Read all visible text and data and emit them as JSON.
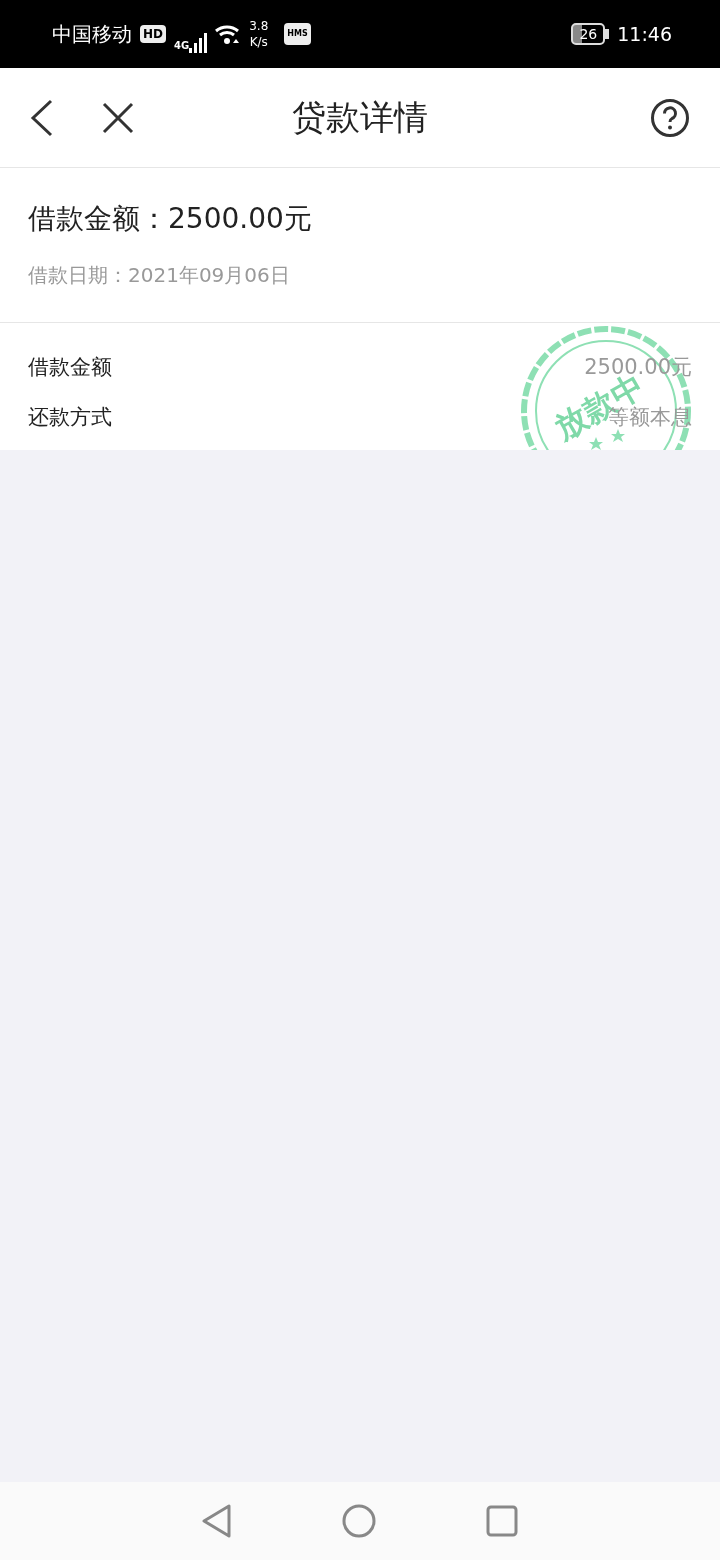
{
  "status_bar": {
    "carrier": "中国移动",
    "hd": "HD",
    "network": "4G",
    "speed_value": "3.8",
    "speed_unit": "K/s",
    "hms": "HMS",
    "battery": "26",
    "time": "11:46"
  },
  "nav": {
    "title": "贷款详情"
  },
  "summary": {
    "amount": "借款金额：2500.00元",
    "date": "借款日期：2021年09月06日"
  },
  "details": [
    {
      "label": "借款金额",
      "value": "2500.00元"
    },
    {
      "label": "还款方式",
      "value": "等额本息"
    }
  ],
  "stamp": {
    "text": "放款中"
  }
}
